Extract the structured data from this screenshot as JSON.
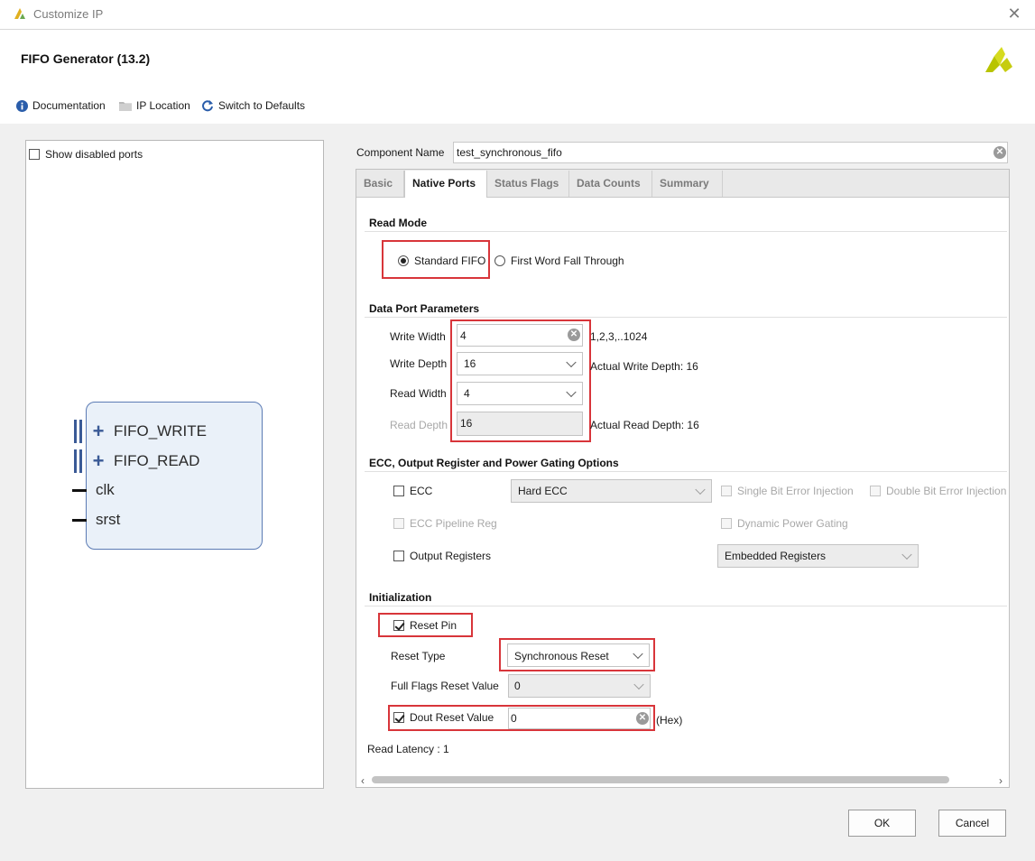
{
  "window": {
    "title": "Customize IP",
    "close_glyph": "✕"
  },
  "ip_title": "FIFO Generator (13.2)",
  "toolbar": {
    "documentation": "Documentation",
    "ip_location": "IP Location",
    "switch_defaults": "Switch to Defaults"
  },
  "left_pane": {
    "show_disabled_ports": "Show disabled ports",
    "ports": [
      "FIFO_WRITE",
      "FIFO_READ",
      "clk",
      "srst"
    ]
  },
  "component": {
    "label": "Component Name",
    "value": "test_synchronous_fifo"
  },
  "tabs": [
    "Basic",
    "Native Ports",
    "Status Flags",
    "Data Counts",
    "Summary"
  ],
  "active_tab": "Native Ports",
  "read_mode": {
    "title": "Read Mode",
    "options": [
      "Standard FIFO",
      "First Word Fall Through"
    ],
    "selected": "Standard FIFO"
  },
  "data_port": {
    "title": "Data Port Parameters",
    "write_width": {
      "label": "Write Width",
      "value": "4",
      "hint": "1,2,3,..1024"
    },
    "write_depth": {
      "label": "Write Depth",
      "value": "16",
      "hint": "Actual Write Depth: 16"
    },
    "read_width": {
      "label": "Read Width",
      "value": "4"
    },
    "read_depth": {
      "label": "Read Depth",
      "value": "16",
      "hint": "Actual Read Depth: 16"
    }
  },
  "ecc": {
    "title": "ECC, Output Register and Power Gating Options",
    "ecc_label": "ECC",
    "ecc_type": "Hard ECC",
    "single_bit": "Single Bit Error Injection",
    "double_bit": "Double Bit Error Injection",
    "pipeline_reg": "ECC Pipeline Reg",
    "dynamic_power": "Dynamic Power Gating",
    "output_registers": "Output Registers",
    "output_reg_type": "Embedded Registers"
  },
  "init": {
    "title": "Initialization",
    "reset_pin": "Reset Pin",
    "reset_type_label": "Reset Type",
    "reset_type": "Synchronous Reset",
    "full_flags_label": "Full Flags Reset Value",
    "full_flags_value": "0",
    "dout_reset_label": "Dout Reset Value",
    "dout_reset_value": "0",
    "hex": "(Hex)"
  },
  "read_latency": "Read Latency : 1",
  "buttons": {
    "ok": "OK",
    "cancel": "Cancel"
  },
  "colors": {
    "highlight": "#d8353a",
    "symbol_fill": "#eaf1f9",
    "symbol_border": "#5b7bb4",
    "info_blue": "#2a5daa"
  },
  "icons": [
    "xilinx-logo",
    "info-icon",
    "folder-icon",
    "refresh-icon",
    "close-icon",
    "clear-icon",
    "chevron-down-icon"
  ]
}
